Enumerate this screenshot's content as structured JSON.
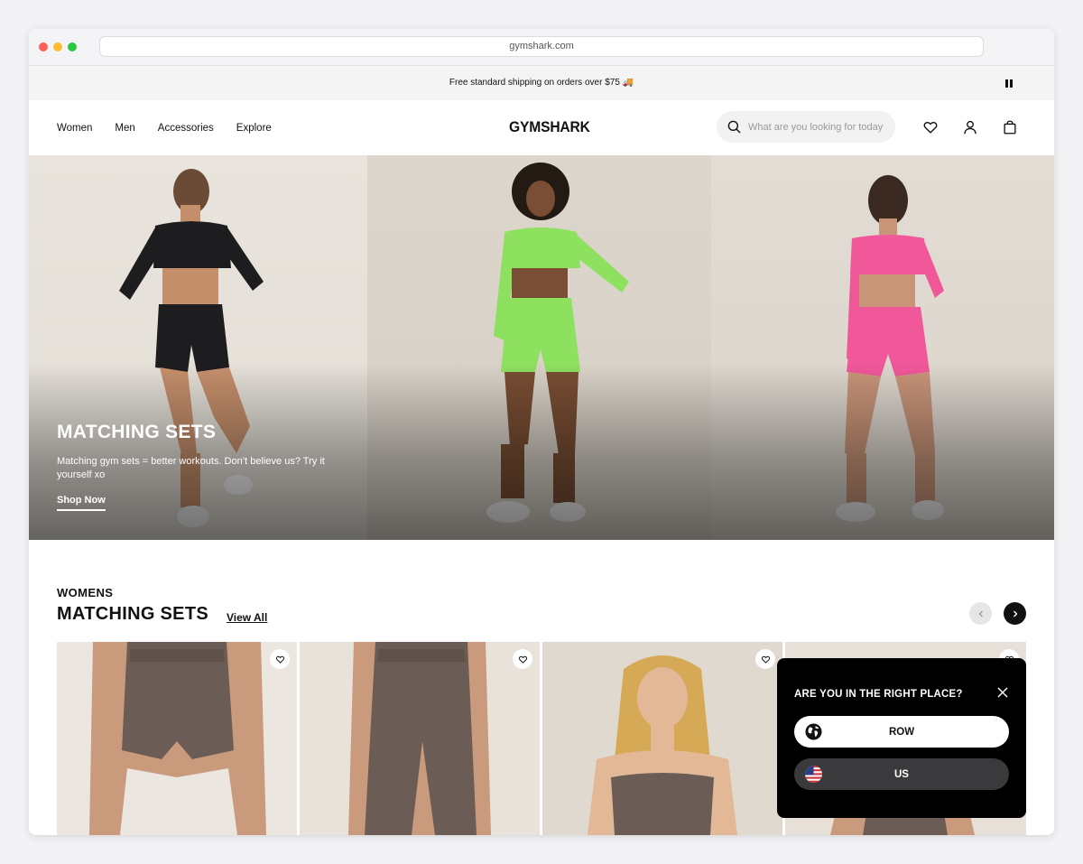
{
  "browser": {
    "url": "gymshark.com",
    "dot_colors": [
      "#ff5f57",
      "#febc2e",
      "#28c840"
    ]
  },
  "announcement": {
    "text": "Free standard shipping on orders over $75 🚚"
  },
  "header": {
    "nav": [
      "Women",
      "Men",
      "Accessories",
      "Explore"
    ],
    "logo": "GYMSHARK",
    "search_placeholder": "What are you looking for today?"
  },
  "hero": {
    "title": "MATCHING SETS",
    "subtitle": "Matching gym sets = better workouts. Don’t believe us? Try it yourself xo",
    "cta": "Shop Now",
    "outfit_colors": [
      "#1d1d1f",
      "#8ee05f",
      "#f0589a"
    ]
  },
  "section": {
    "kicker": "WOMENS",
    "title": "MATCHING SETS",
    "view_all": "View All"
  },
  "products": [
    {
      "name": "shorts",
      "color": "#6b5d55",
      "bg": "#ebe6df"
    },
    {
      "name": "leggings",
      "color": "#6b5d55",
      "bg": "#e8e2da"
    },
    {
      "name": "sports-bra",
      "color": "#6b5d55",
      "bg": "#e0d9cf"
    },
    {
      "name": "set",
      "color": "#6b5d55",
      "bg": "#e6e0d8"
    }
  ],
  "region_popup": {
    "title": "ARE YOU IN THE RIGHT PLACE?",
    "options": [
      "ROW",
      "US"
    ]
  },
  "colors": {
    "accent": "#111111",
    "popup_bg": "#000000"
  }
}
